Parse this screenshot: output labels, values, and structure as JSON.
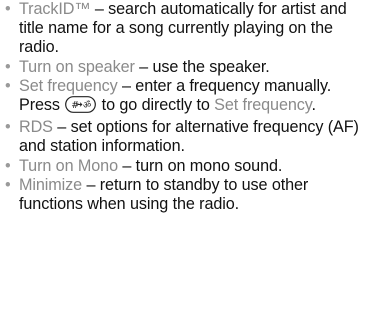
{
  "items": [
    {
      "term": "TrackID™",
      "text": " – search automatically for artist and title name for a song currently playing on the radio."
    },
    {
      "term": "Turn on speaker",
      "text": " – use the speaker."
    },
    {
      "term": "Set frequency",
      "text_before": " – enter a frequency manually. Press ",
      "key_icon": "hash-key-icon",
      "text_after": " to go directly to ",
      "term2": "Set frequency",
      "text_end": "."
    },
    {
      "term": "RDS",
      "text": " – set options for alternative frequency (AF) and station information."
    },
    {
      "term": "Turn on Mono",
      "text": " – turn on mono sound."
    },
    {
      "term": "Minimize",
      "text": " – return to standby to use other functions when using the radio."
    }
  ],
  "colors": {
    "term": "#8a8a8a",
    "bullet": "#9a9a9a",
    "text": "#111111"
  }
}
